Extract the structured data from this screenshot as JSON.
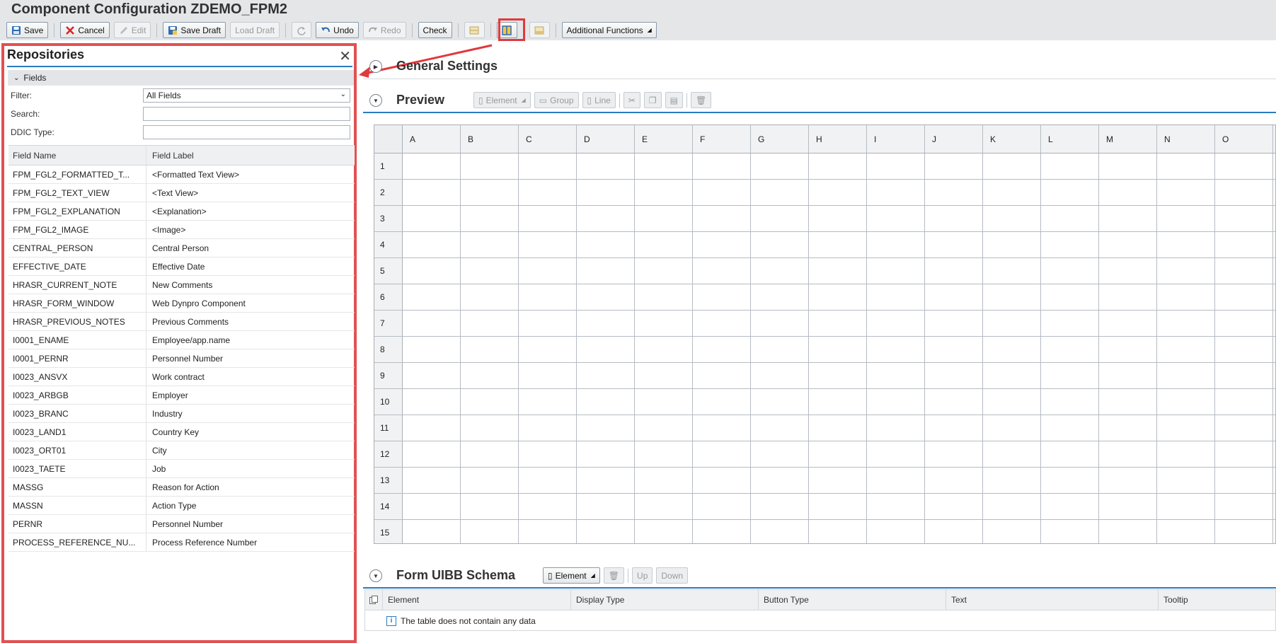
{
  "app": {
    "title": "Component Configuration ZDEMO_FPM2"
  },
  "toolbar": {
    "save": "Save",
    "cancel": "Cancel",
    "edit": "Edit",
    "save_draft": "Save Draft",
    "load_draft": "Load Draft",
    "undo": "Undo",
    "redo": "Redo",
    "check": "Check",
    "additional_functions": "Additional Functions"
  },
  "repositories": {
    "title": "Repositories",
    "fields_section": "Fields",
    "filter_label": "Filter:",
    "filter_value": "All Fields",
    "search_label": "Search:",
    "search_value": "",
    "ddic_label": "DDIC Type:",
    "ddic_value": "",
    "col_field_name": "Field Name",
    "col_field_label": "Field Label",
    "rows": [
      {
        "name": "FPM_FGL2_FORMATTED_T...",
        "label": "<Formatted Text View>"
      },
      {
        "name": "FPM_FGL2_TEXT_VIEW",
        "label": "<Text View>"
      },
      {
        "name": "FPM_FGL2_EXPLANATION",
        "label": "<Explanation>"
      },
      {
        "name": "FPM_FGL2_IMAGE",
        "label": "<Image>"
      },
      {
        "name": "CENTRAL_PERSON",
        "label": "Central Person"
      },
      {
        "name": "EFFECTIVE_DATE",
        "label": "Effective Date"
      },
      {
        "name": "HRASR_CURRENT_NOTE",
        "label": "New Comments"
      },
      {
        "name": "HRASR_FORM_WINDOW",
        "label": "Web Dynpro Component"
      },
      {
        "name": "HRASR_PREVIOUS_NOTES",
        "label": "Previous Comments"
      },
      {
        "name": "I0001_ENAME",
        "label": "Employee/app.name"
      },
      {
        "name": "I0001_PERNR",
        "label": "Personnel Number"
      },
      {
        "name": "I0023_ANSVX",
        "label": "Work contract"
      },
      {
        "name": "I0023_ARBGB",
        "label": "Employer"
      },
      {
        "name": "I0023_BRANC",
        "label": "Industry"
      },
      {
        "name": "I0023_LAND1",
        "label": "Country Key"
      },
      {
        "name": "I0023_ORT01",
        "label": "City"
      },
      {
        "name": "I0023_TAETE",
        "label": "Job"
      },
      {
        "name": "MASSG",
        "label": "Reason for Action"
      },
      {
        "name": "MASSN",
        "label": "Action Type"
      },
      {
        "name": "PERNR",
        "label": "Personnel Number"
      },
      {
        "name": "PROCESS_REFERENCE_NU...",
        "label": "Process Reference Number"
      }
    ]
  },
  "general_settings": {
    "title": "General Settings"
  },
  "preview": {
    "title": "Preview",
    "element_btn": "Element",
    "group_btn": "Group",
    "line_btn": "Line",
    "columns": [
      "A",
      "B",
      "C",
      "D",
      "E",
      "F",
      "G",
      "H",
      "I",
      "J",
      "K",
      "L",
      "M",
      "N",
      "O"
    ],
    "rows": [
      "1",
      "2",
      "3",
      "4",
      "5",
      "6",
      "7",
      "8",
      "9",
      "10",
      "11",
      "12",
      "13",
      "14",
      "15"
    ]
  },
  "form_uibb": {
    "title": "Form UIBB Schema",
    "element_btn": "Element",
    "up_btn": "Up",
    "down_btn": "Down",
    "columns": [
      "Element",
      "Display Type",
      "Button Type",
      "Text",
      "Tooltip"
    ],
    "empty_text": "The table does not contain any data"
  }
}
